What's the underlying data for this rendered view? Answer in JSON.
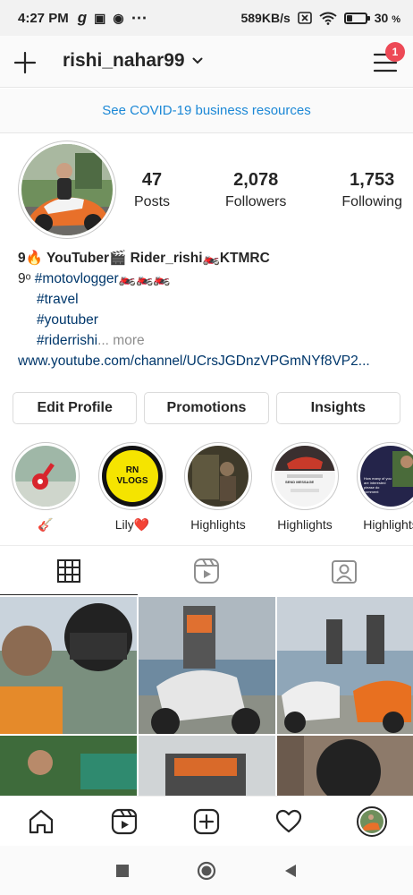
{
  "status_bar": {
    "time": "4:27 PM",
    "app_icons": [
      "g",
      "▣",
      "◉",
      "⋯"
    ],
    "network_speed": "589KB/s",
    "battery_percent": "30",
    "battery_unit": "%",
    "battery_level": 0.3
  },
  "header": {
    "username": "rishi_nahar99",
    "notification_count": "1"
  },
  "covid_banner": "See COVID-19 business resources",
  "profile": {
    "stats": [
      {
        "num": "47",
        "label": "Posts"
      },
      {
        "num": "2,078",
        "label": "Followers"
      },
      {
        "num": "1,753",
        "label": "Following"
      }
    ],
    "bio": {
      "name_line": "9🔥 YouTuber🎬 Rider_rishi🏍️KTMRC",
      "line2_prefix": "9ᵒ ",
      "line2_tag": "#motovlogger",
      "line2_suffix": "🏍️🏍️🏍️",
      "tag_travel": "#travel",
      "tag_youtuber": "#youtuber",
      "tag_rider": "#riderrishi",
      "more": "... more",
      "link": "www.youtube.com/channel/UCrsJGDnzVPGmNYf8VP2..."
    },
    "buttons": [
      "Edit Profile",
      "Promotions",
      "Insights"
    ]
  },
  "highlights": [
    {
      "label": "🎸",
      "icon": "guitar-icon"
    },
    {
      "label": "Lily❤️",
      "logo_text": "RN\nVLOGS"
    },
    {
      "label": "Highlights"
    },
    {
      "label": "Highlights",
      "screen_text": "SEND MESSAGE"
    },
    {
      "label": "Highlights",
      "screen_text": "How many of you are interested please do comment"
    }
  ],
  "tabs": [
    "grid-icon",
    "reels-icon",
    "tagged-icon"
  ],
  "bottom_nav": [
    "home-icon",
    "reels-icon",
    "create-icon",
    "activity-icon",
    "profile-avatar"
  ],
  "system_nav": [
    "recents-icon",
    "home-icon",
    "back-icon"
  ]
}
